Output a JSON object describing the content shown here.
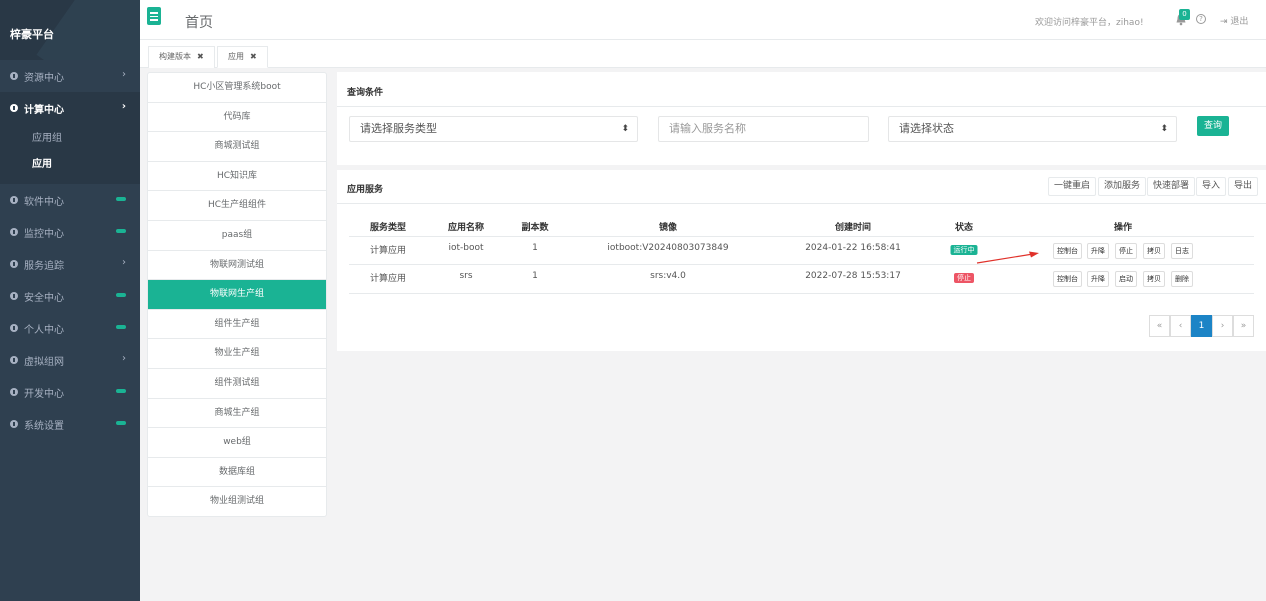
{
  "sidebar": {
    "brand": "梓豪平台",
    "menu": [
      {
        "label": "资源中心"
      },
      {
        "label": "计算中心"
      },
      {
        "label": "软件中心"
      },
      {
        "label": "监控中心"
      },
      {
        "label": "服务追踪"
      },
      {
        "label": "安全中心"
      },
      {
        "label": "个人中心"
      },
      {
        "label": "虚拟组网"
      },
      {
        "label": "开发中心"
      },
      {
        "label": "系统设置"
      }
    ],
    "submenu": [
      {
        "label": "应用组"
      },
      {
        "label": "应用"
      }
    ]
  },
  "header": {
    "title": "首页",
    "welcome": "欢迎访问梓豪平台，zihao!",
    "notify_count": "0",
    "help": "?",
    "logout": "退出"
  },
  "tabs": [
    {
      "label": "构建版本"
    },
    {
      "label": "应用"
    }
  ],
  "groups": [
    "HC小区管理系统boot",
    "代码库",
    "商城测试组",
    "HC知识库",
    "HC生产组组件",
    "paas组",
    "物联网测试组",
    "物联网生产组",
    "组件生产组",
    "物业生产组",
    "组件测试组",
    "商城生产组",
    "web组",
    "数据库组",
    "物业组测试组"
  ],
  "query": {
    "title": "查询条件",
    "service_type_placeholder": "请选择服务类型",
    "service_name_placeholder": "请输入服务名称",
    "status_placeholder": "请选择状态",
    "search_label": "查询"
  },
  "services": {
    "title": "应用服务",
    "toolbar": [
      "一键重启",
      "添加服务",
      "快速部署",
      "导入",
      "导出"
    ],
    "columns": [
      "服务类型",
      "应用名称",
      "副本数",
      "镜像",
      "创建时间",
      "状态",
      "操作"
    ],
    "rows": [
      {
        "type": "计算应用",
        "name": "iot-boot",
        "replicas": "1",
        "image": "iotboot:V20240803073849",
        "created": "2024-01-22 16:58:41",
        "status": "运行中",
        "status_color": "#1ab394",
        "actions": [
          "控制台",
          "升降",
          "停止",
          "拷贝",
          "日志"
        ]
      },
      {
        "type": "计算应用",
        "name": "srs",
        "replicas": "1",
        "image": "srs:v4.0",
        "created": "2022-07-28 15:53:17",
        "status": "停止",
        "status_color": "#ed5565",
        "actions": [
          "控制台",
          "升降",
          "启动",
          "拷贝",
          "删除"
        ]
      }
    ]
  },
  "pagination": {
    "first": "«",
    "prev": "‹",
    "current": "1",
    "next": "›",
    "last": "»"
  },
  "colors": {
    "accent": "#1ab394",
    "sidebar": "#2f4050",
    "pager_active": "#1c84c6"
  }
}
